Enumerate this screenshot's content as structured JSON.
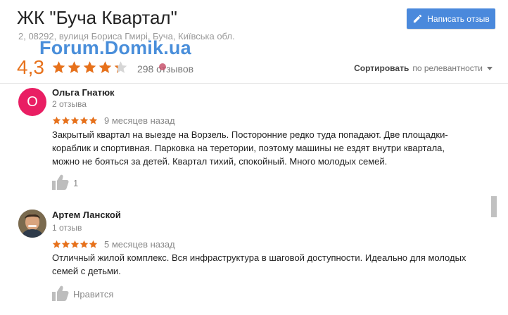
{
  "header": {
    "title": "ЖК \"Буча Квартал\"",
    "address": "2, 08292, вулиця Бориса Гмирі, Буча, Київська обл.",
    "watermark": "Forum.Domik.ua",
    "rating_value": "4,3",
    "rating_stars": 4.3,
    "review_count": "298 отзывов",
    "write_button_label": "Написать отзыв",
    "sort_label": "Сортировать",
    "sort_value": "по релевантности"
  },
  "colors": {
    "accent_orange": "#e7711b",
    "button_blue": "#4a89dc",
    "avatar_pink": "#e91e63",
    "watermark_blue": "#2a7bd4"
  },
  "reviews": [
    {
      "avatar_letter": "О",
      "author": "Ольга Гнатюк",
      "author_reviews": "2 отзыва",
      "stars": 5,
      "date": "9 месяцев назад",
      "text": "Закрытый квартал на выезде на Ворзель. Посторонние редко туда попадают. Две площадки-кораблик и спортивная. Парковка на теретории, поэтому машины не ездят внутри квартала, можно не бояться за детей. Квартал тихий, спокойный.  Много молодых семей.",
      "likes": "1"
    },
    {
      "avatar_letter": "",
      "author": "Артем Ланской",
      "author_reviews": "1 отзыв",
      "stars": 5,
      "date": "5 месяцев назад",
      "text": "Отличный жилой комплекс. Вся инфраструктура в шаговой доступности. Идеально для молодых семей с детьми.",
      "likes": "Нравится"
    }
  ]
}
